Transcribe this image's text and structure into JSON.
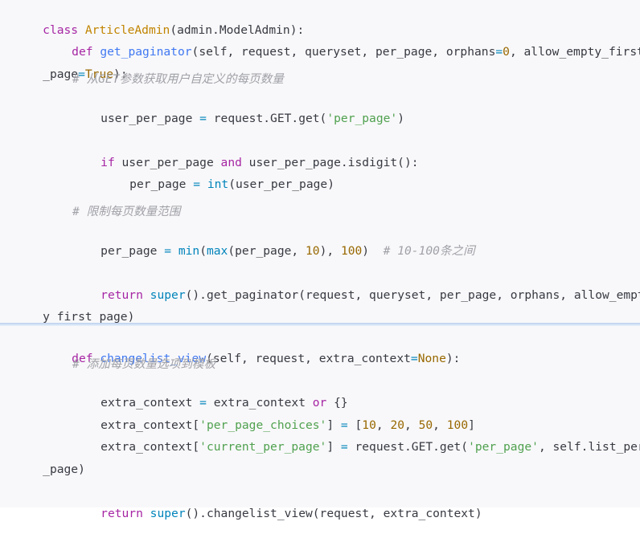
{
  "code_block_1": {
    "line_1": {
      "kw": "class",
      "sp": " ",
      "name": "ArticleAdmin",
      "rest": "(admin.ModelAdmin):"
    },
    "line_2": {
      "kw": "def",
      "sp": " ",
      "name": "get_paginator",
      "args": "(self, request, queryset, per_page, orphans",
      "eq": "=",
      "zero": "0",
      "rest": ", allow_empty_first"
    },
    "line_3": {
      "pre": "_page",
      "eq": "=",
      "true": "True",
      "rest": "):"
    },
    "line_4": {
      "comment": "# 从GET参数获取用户自定义的每页数量"
    },
    "line_5": {
      "pre": "user_per_page ",
      "eq": "=",
      "mid": " request.GET.get(",
      "str": "'per_page'",
      "rest": ")"
    },
    "line_6": {
      "kw": "if",
      "mid": " user_per_page ",
      "kw2": "and",
      "rest": " user_per_page.isdigit():"
    },
    "line_7": {
      "pre": "per_page ",
      "eq": "=",
      "sp": " ",
      "builtin": "int",
      "rest": "(user_per_page)"
    },
    "line_8": {
      "comment": "# 限制每页数量范围"
    },
    "line_9": {
      "pre": "per_page ",
      "eq": "=",
      "sp": " ",
      "min": "min",
      "p1": "(",
      "max": "max",
      "p2": "(per_page, ",
      "n1": "10",
      "p3": "), ",
      "n2": "100",
      "p4": ")  ",
      "comment": "# 10-100条之间"
    },
    "line_10": {
      "kw": "return",
      "sp": " ",
      "builtin": "super",
      "rest": "().get_paginator(request, queryset, per_page, orphans, allow_empt"
    },
    "line_11": {
      "text": "y_first_page)"
    }
  },
  "code_block_2": {
    "line_1": {
      "kw": "def",
      "sp": " ",
      "name": "changelist_view",
      "args": "(self, request, extra_context",
      "eq": "=",
      "none": "None",
      "rest": "):"
    },
    "line_2": {
      "comment": "# 添加每页数量选项到模板"
    },
    "line_3": {
      "pre": "extra_context ",
      "eq": "=",
      "mid": " extra_context ",
      "kw": "or",
      "rest": " {}"
    },
    "line_4": {
      "pre": "extra_context[",
      "str": "'per_page_choices'",
      "mid": "] ",
      "eq": "=",
      "lb": " [",
      "n1": "10",
      "c1": ", ",
      "n2": "20",
      "c2": ", ",
      "n3": "50",
      "c3": ", ",
      "n4": "100",
      "rest": "]"
    },
    "line_5": {
      "pre": "extra_context[",
      "str": "'current_per_page'",
      "mid": "] ",
      "eq": "=",
      "mid2": " request.GET.get(",
      "str2": "'per_page'",
      "rest": ", self.list_per"
    },
    "line_6": {
      "text": "_page)"
    },
    "line_7": {
      "kw": "return",
      "sp": " ",
      "builtin": "super",
      "rest": "().changelist_view(request, extra_context)"
    }
  },
  "colors": {
    "keyword": "#a626a4",
    "function": "#4078f2",
    "class_name": "#c18401",
    "number": "#986801",
    "string": "#50a14f",
    "builtin": "#0184bb",
    "comment": "#a0a1a7",
    "text": "#383a42",
    "background": "#f8f8fa"
  }
}
